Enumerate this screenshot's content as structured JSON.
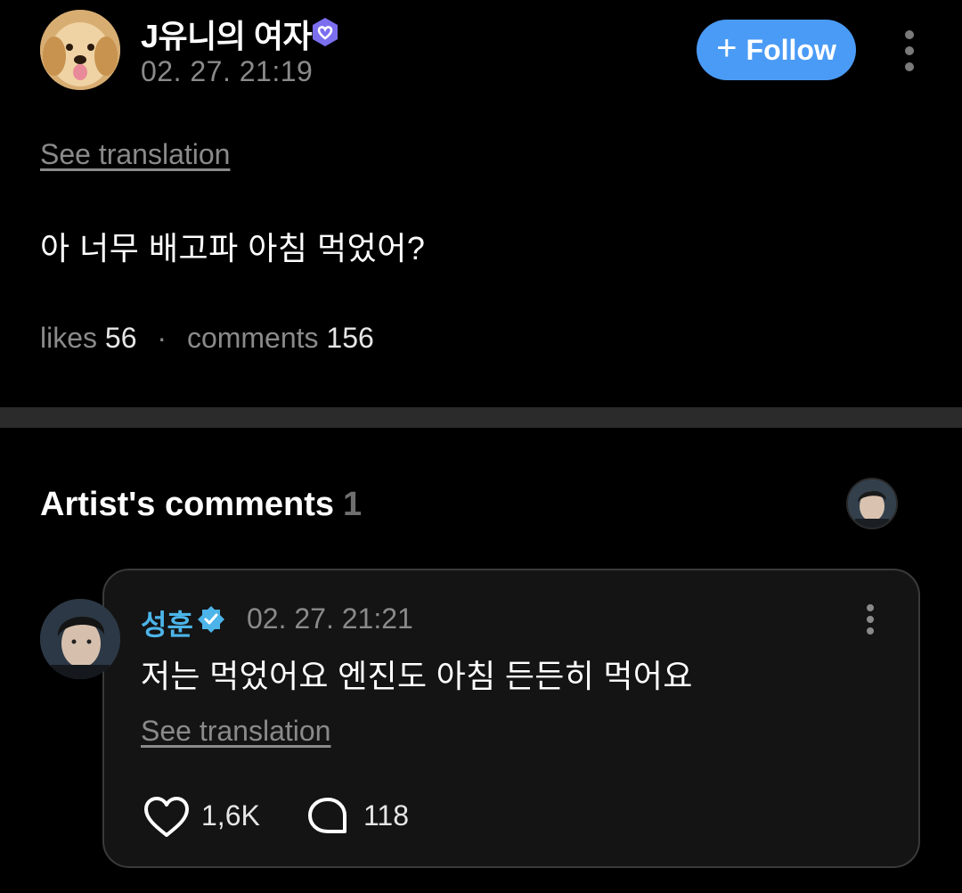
{
  "post": {
    "author_name": "J유니의 여자",
    "time": "02. 27. 21:19",
    "follow_label": "Follow",
    "see_translation": "See translation",
    "body": "아 너무 배고파 아침 먹었어?",
    "likes_label": "likes",
    "likes_count": "56",
    "separator": "·",
    "comments_label": "comments",
    "comments_count": "156"
  },
  "artist_comments": {
    "title": "Artist's comments",
    "count": "1"
  },
  "comment": {
    "author_name": "성훈",
    "time": "02. 27. 21:21",
    "text": "저는 먹었어요 엔진도 아침 든든히 먹어요",
    "see_translation": "See translation",
    "likes": "1,6K",
    "replies": "118"
  },
  "colors": {
    "follow_button": "#4a9bf5",
    "artist_name": "#4cb4e8",
    "verified_badge": "#7b6ff0",
    "artist_badge": "#4cb4e8"
  },
  "icons": {
    "follow": "plus-icon",
    "more": "more-vertical-icon",
    "like": "heart-outline-icon",
    "reply": "speech-bubble-icon"
  }
}
